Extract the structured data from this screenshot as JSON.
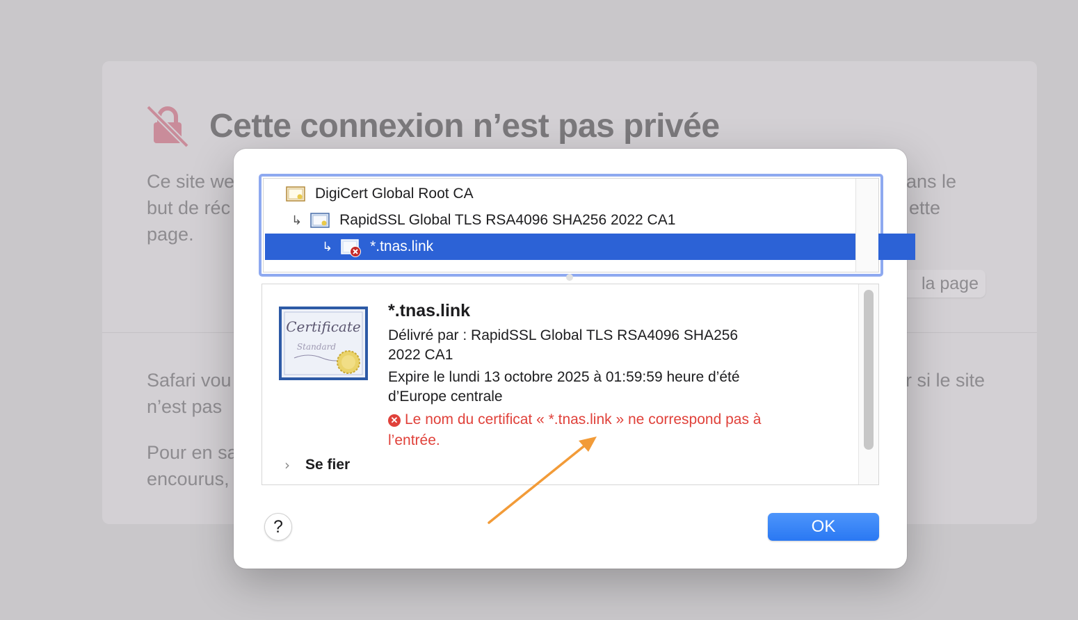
{
  "background_page": {
    "title": "Cette connexion n’est pas privée",
    "para1_line1": "Ce site we",
    "para1_line1_right": "lans le",
    "para1_line2": "but de réc",
    "para1_line2_right": "ette",
    "para1_line3": "page.",
    "reload_button_partial": "la page",
    "para2_line1": "Safari vou",
    "para2_line1_right": "r si le site",
    "para2_line2": "n’est pas",
    "para3_line1": "Pour en sa",
    "para3_line2": "encourus,",
    "lock_icon": "unlocked-lock-slash-icon",
    "lock_color": "#c98c9a"
  },
  "dialog": {
    "chain": [
      {
        "label": "DigiCert Global Root CA",
        "icon": "certificate-icon"
      },
      {
        "label": "RapidSSL Global TLS RSA4096 SHA256 2022 CA1",
        "icon": "certificate-icon"
      },
      {
        "label": "*.tnas.link",
        "icon": "certificate-error-icon",
        "selected": true
      }
    ],
    "details": {
      "cert_image_text_1": "Certificate",
      "cert_image_text_2": "Standard",
      "name": "*.tnas.link",
      "issued_by_line1": "Délivré par : RapidSSL Global TLS RSA4096 SHA256",
      "issued_by_line2": "2022 CA1",
      "expires_line1": "Expire le lundi 13 octobre 2025 à 01:59:59 heure d’été",
      "expires_line2": "d’Europe centrale",
      "error_line1": "Le nom du certificat « *.tnas.link » ne correspond pas à",
      "error_line2": "l’entrée.",
      "trust_label": "Se fier"
    },
    "help_label": "?",
    "ok_label": "OK"
  },
  "colors": {
    "selection": "#2c62d6",
    "error": "#e0413a",
    "ok_button": "#2a78f3",
    "annotation_arrow": "#f29b38"
  }
}
